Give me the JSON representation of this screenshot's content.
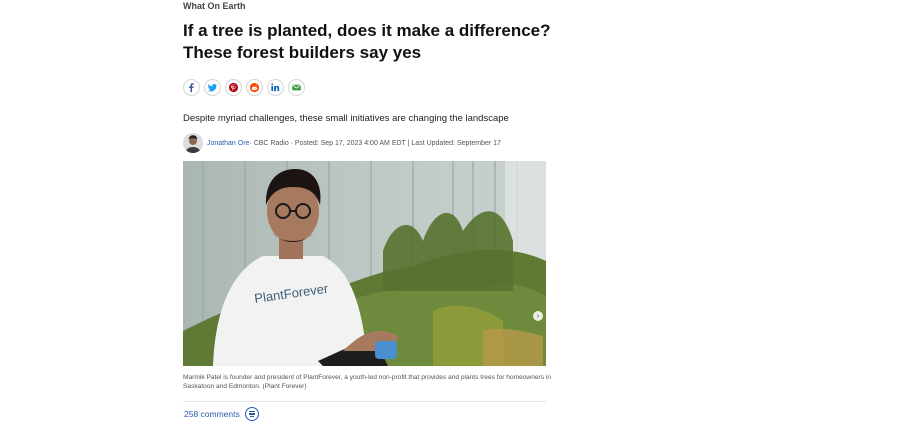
{
  "article": {
    "kicker": "What On Earth",
    "headline": "If a tree is planted, does it make a difference? These forest builders say yes",
    "deck": "Despite myriad challenges, these small initiatives are changing the landscape",
    "byline": {
      "author": "Jonathan Ore",
      "meta": " · CBC Radio · Posted: Sep 17, 2023 4:00 AM EDT | Last Updated: September 17"
    },
    "image": {
      "shirt_text": "PlantForever"
    },
    "caption": "Marmik Patel is founder and president of PlantForever, a youth-led non-profit that provides and plants trees for homeowners in Saskatoon and Edmonton. (Plant Forever)",
    "comments_label": "258 comments"
  },
  "share_icons": [
    {
      "name": "facebook-icon",
      "color": "#3b5998"
    },
    {
      "name": "twitter-icon",
      "color": "#1da1f2"
    },
    {
      "name": "pinterest-icon",
      "color": "#bd081c"
    },
    {
      "name": "reddit-icon",
      "color": "#ff4500"
    },
    {
      "name": "linkedin-icon",
      "color": "#0a66c2"
    },
    {
      "name": "email-icon",
      "color": "#3f9a3f"
    }
  ],
  "colors": {
    "link": "#2a5db0"
  }
}
